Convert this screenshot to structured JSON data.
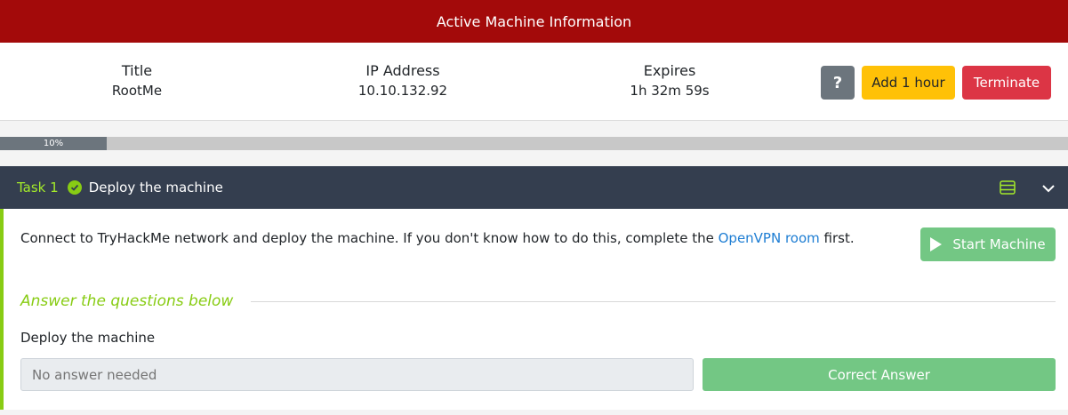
{
  "active_machine": {
    "header": "Active Machine Information",
    "title_label": "Title",
    "title_value": "RootMe",
    "ip_label": "IP Address",
    "ip_value": "10.10.132.92",
    "expires_label": "Expires",
    "expires_value": "1h 32m 59s",
    "help_label": "?",
    "add_hour_label": "Add 1 hour",
    "terminate_label": "Terminate"
  },
  "progress": {
    "label": "10%",
    "value": 0.1
  },
  "task": {
    "number": "Task 1",
    "title": "Deploy the machine",
    "text_before": "Connect to TryHackMe network and deploy the machine. If you don't know how to do this, complete the ",
    "link_text": "OpenVPN room",
    "text_after": " first.",
    "start_button": "Start Machine",
    "answer_heading": "Answer the questions below",
    "question": "Deploy the machine",
    "answer_placeholder": "No answer needed",
    "correct_button": "Correct Answer"
  },
  "icons": [
    "check-icon",
    "list-icon",
    "chevron-down-icon",
    "play-icon"
  ],
  "colors": {
    "header": "#a30a0a",
    "accent": "#88cc14",
    "task_bar": "#343e4f"
  }
}
